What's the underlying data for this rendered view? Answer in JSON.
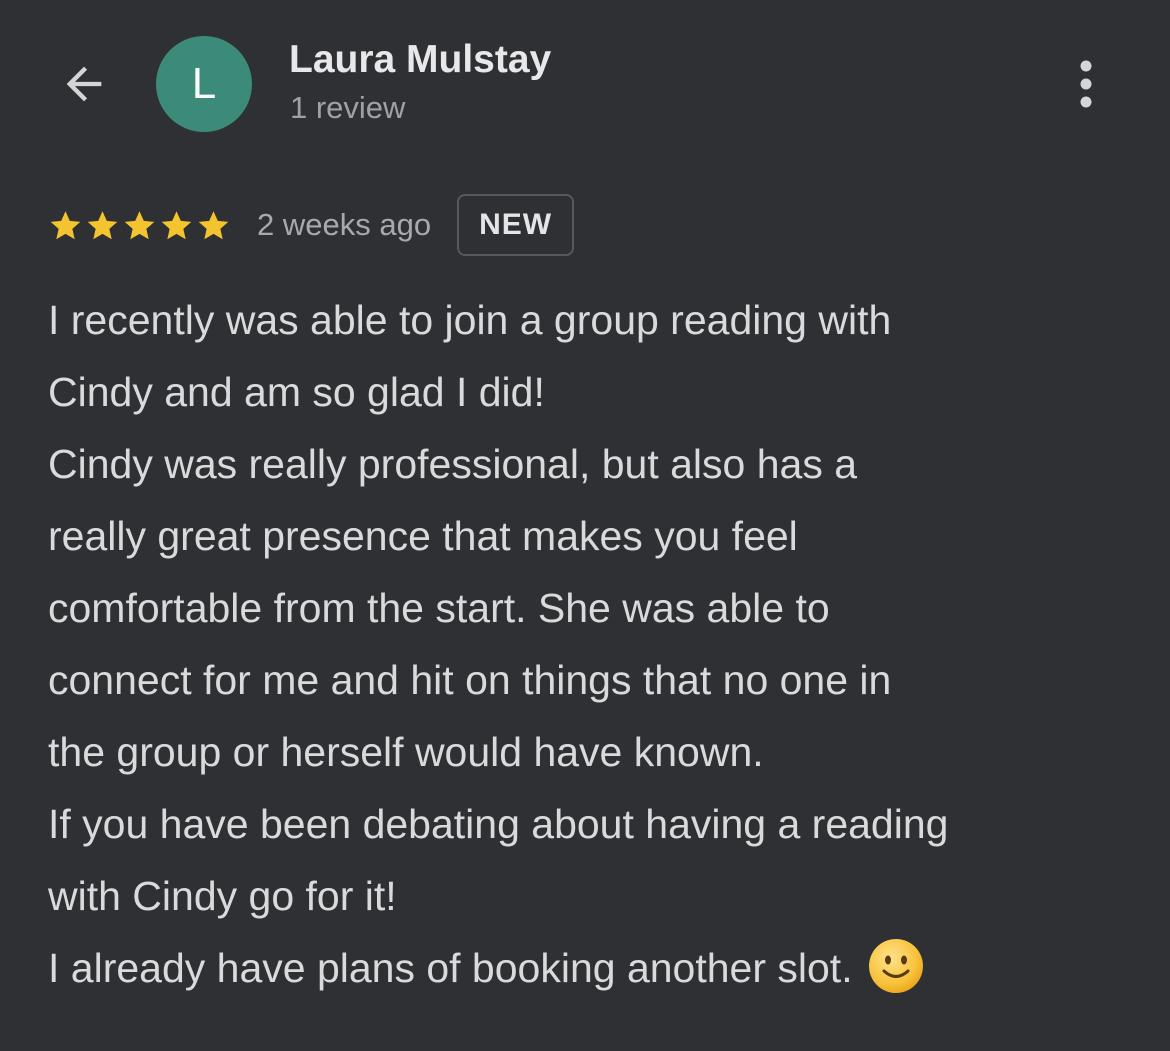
{
  "header": {
    "avatar_letter": "L",
    "reviewer_name": "Laura Mulstay",
    "review_count": "1 review",
    "icons": {
      "back": "arrow-back-icon",
      "more": "more-vert-icon"
    }
  },
  "review": {
    "rating": 5,
    "rating_max": 5,
    "time_ago": "2 weeks ago",
    "badge": "NEW",
    "lines": [
      "I recently was able to join a group reading with",
      "Cindy and am so glad I did!",
      "Cindy was really professional, but also has a",
      "really great presence that makes you feel",
      "comfortable from the start. She was able to",
      "connect for me and hit on things that no one in",
      "the group or herself would have known.",
      "If you have been debating about having a reading",
      "with Cindy go for it!",
      "I already have plans of booking another slot."
    ],
    "trailing_emoji": "slightly-smiling-face"
  },
  "colors": {
    "background": "#2f3033",
    "avatar": "#3b8b78",
    "star": "#f4c430",
    "text": "#d9dadc",
    "muted": "#9fa1a5"
  }
}
